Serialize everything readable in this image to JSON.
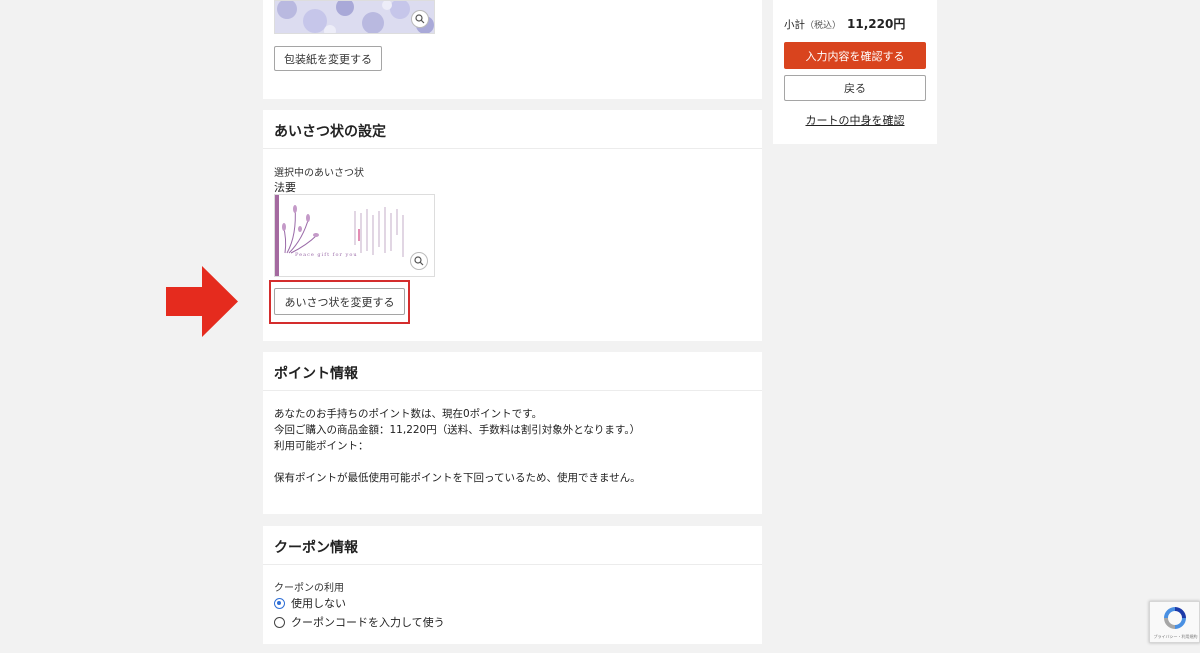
{
  "wrapping": {
    "change_button": "包装紙を変更する"
  },
  "greeting": {
    "title": "あいさつ状の設定",
    "selected_label": "選択中のあいさつ状",
    "selected_name": "法要",
    "card_caption": "Peace gift for you",
    "change_button": "あいさつ状を変更する"
  },
  "points": {
    "title": "ポイント情報",
    "line1": "あなたのお手持ちのポイント数は、現在0ポイントです。",
    "line2": "今回ご購入の商品金額：11,220円（送料、手数料は割引対象外となります。）",
    "line3": "利用可能ポイント：",
    "line4": "保有ポイントが最低使用可能ポイントを下回っているため、使用できません。"
  },
  "coupon": {
    "title": "クーポン情報",
    "usage_label": "クーポンの利用",
    "options": [
      {
        "label": "使用しない",
        "checked": true
      },
      {
        "label": "クーポンコードを入力して使う",
        "checked": false
      }
    ]
  },
  "summary": {
    "subtotal_label": "小計",
    "tax_label": "（税込）",
    "subtotal_value": "11,220円",
    "confirm_button": "入力内容を確認する",
    "back_button": "戻る",
    "cart_link": "カートの中身を確認"
  },
  "recaptcha": {
    "footer": "プライバシー・利用規約"
  },
  "colors": {
    "accent": "#d9441e",
    "highlight": "#d42d2d",
    "arrow": "#e52b1e",
    "radio": "#2f6fd6"
  }
}
